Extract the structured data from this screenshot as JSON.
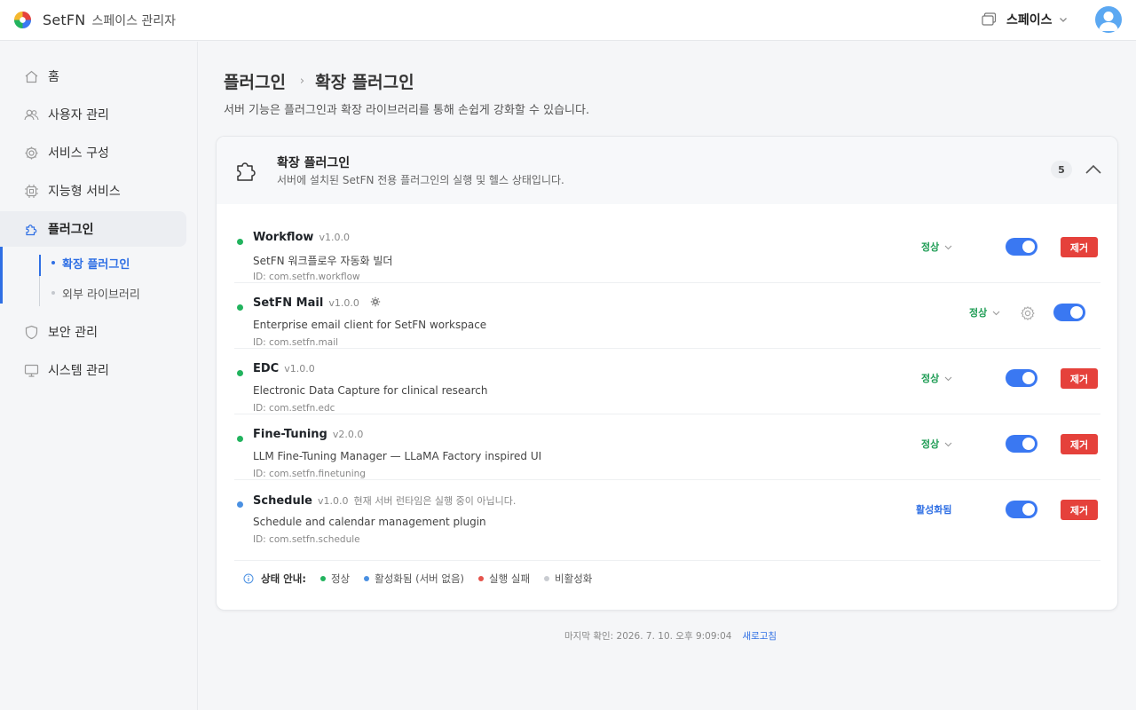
{
  "app": {
    "brand": "SetFN",
    "subtitle": "스페이스 관리자",
    "space_label": "스페이스"
  },
  "colors": {
    "accent": "#2f6fe4",
    "toggle_on": "#3a78f2",
    "remove": "#e5413b",
    "status_ok": "#22b35e",
    "status_active": "#4a90e2",
    "status_failed": "#e5534b",
    "status_disabled": "#c9ccd1"
  },
  "sidebar": {
    "items": [
      {
        "label": "홈",
        "icon": "home-icon"
      },
      {
        "label": "사용자 관리",
        "icon": "users-icon"
      },
      {
        "label": "서비스 구성",
        "icon": "gear-icon"
      },
      {
        "label": "지능형 서비스",
        "icon": "chip-icon"
      },
      {
        "label": "플러그인",
        "icon": "puzzle-icon",
        "active": true
      },
      {
        "label": "보안 관리",
        "icon": "shield-icon"
      },
      {
        "label": "시스템 관리",
        "icon": "monitor-icon"
      }
    ],
    "sub_items": [
      {
        "label": "확장 플러그인",
        "active": true
      },
      {
        "label": "외부 라이브러리",
        "active": false
      }
    ]
  },
  "page": {
    "breadcrumb_parent": "플러그인",
    "breadcrumb_sep": "›",
    "breadcrumb_current": "확장 플러그인",
    "description": "서버 기능은 플러그인과 확장 라이브러리를 통해 손쉽게 강화할 수 있습니다."
  },
  "card": {
    "title": "확장 플러그인",
    "description": "서버에 설치된 SetFN 전용 플러그인의 실행 및 헬스 상태입니다.",
    "count": "5"
  },
  "plugins": [
    {
      "name": "Workflow",
      "version": "v1.0.0",
      "note": "",
      "description": "SetFN 워크플로우 자동화 빌더",
      "id": "ID: com.setfn.workflow",
      "health": "정상",
      "enabled": true,
      "remove_label": "제거",
      "status": "ok"
    },
    {
      "name": "SetFN Mail",
      "version": "v1.0.0",
      "note": "",
      "description": "Enterprise email client for SetFN workspace",
      "id": "ID: com.setfn.mail",
      "health": "정상",
      "enabled": true,
      "remove_label": "",
      "status": "ok"
    },
    {
      "name": "EDC",
      "version": "v1.0.0",
      "note": "",
      "description": "Electronic Data Capture for clinical research",
      "id": "ID: com.setfn.edc",
      "health": "정상",
      "enabled": true,
      "remove_label": "제거",
      "status": "ok"
    },
    {
      "name": "Fine-Tuning",
      "version": "v2.0.0",
      "note": "",
      "description": "LLM Fine-Tuning Manager — LLaMA Factory inspired UI",
      "id": "ID: com.setfn.finetuning",
      "health": "정상",
      "enabled": true,
      "remove_label": "제거",
      "status": "ok"
    },
    {
      "name": "Schedule",
      "version": "v1.0.0",
      "note": "현재 서버 런타임은 실행 중이 아닙니다.",
      "description": "Schedule and calendar management plugin",
      "id": "ID: com.setfn.schedule",
      "health": "활성화됨",
      "enabled": true,
      "remove_label": "제거",
      "status": "active"
    }
  ],
  "legend": {
    "title": "상태 안내:",
    "items": [
      "정상",
      "활성화됨 (서버 없음)",
      "실행 실패",
      "비활성화"
    ]
  },
  "footer": {
    "last_checked": "마지막 확인: 2026. 7. 10. 오후 9:09:04",
    "refresh": "새로고침"
  }
}
